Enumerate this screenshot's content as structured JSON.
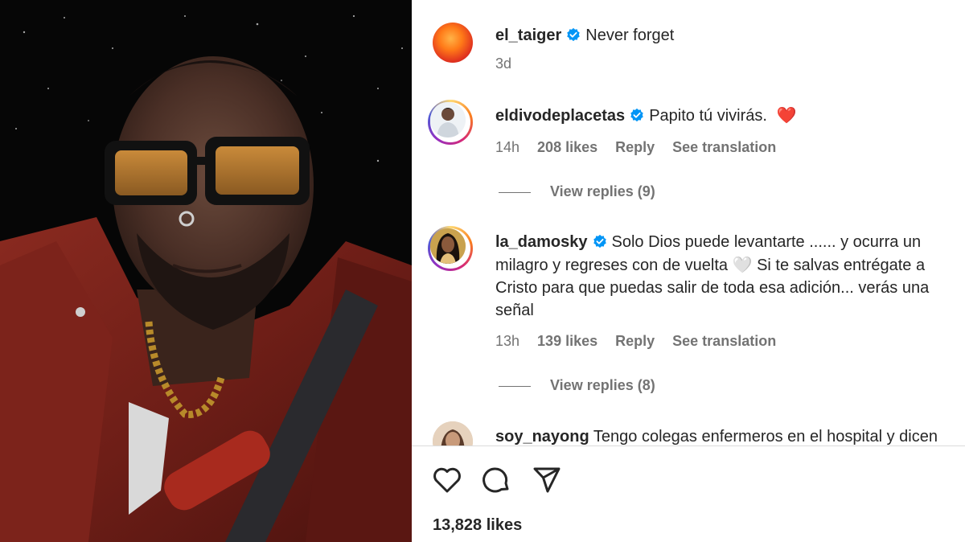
{
  "post": {
    "author": "el_taiger",
    "caption": "Never forget",
    "age": "3d",
    "total_likes": "13,828 likes"
  },
  "comments": [
    {
      "user": "eldivodeplacetas",
      "text": "Papito tú vivirás.",
      "emoji": "❤️",
      "time": "14h",
      "likes": "208 likes",
      "reply_label": "Reply",
      "translate_label": "See translation",
      "view_replies": "View replies (9)"
    },
    {
      "user": "la_damosky",
      "text_line1": "Solo Dios puede levantarte ...... y ocurra un",
      "text_line2": "milagro y regreses con de vuelta",
      "text_line2_emoji": "🤍",
      "text_line2_end": "Si te salvas entrégate a",
      "text_line3": "Cristo para que puedas salir de toda esa adición... verás una",
      "text_line4": "señal",
      "time": "13h",
      "likes": "139 likes",
      "reply_label": "Reply",
      "translate_label": "See translation",
      "view_replies": "View replies (8)"
    },
    {
      "user": "soy_nayong",
      "text": "Tengo colegas enfermeros en el hospital y dicen"
    }
  ],
  "icons": {
    "like": "heart-icon",
    "comment": "comment-icon",
    "share": "share-icon",
    "verified": "verified-badge-icon"
  },
  "colors": {
    "verified_blue": "#0095f6",
    "heart_red": "#e0243a",
    "muted_text": "#737373"
  }
}
